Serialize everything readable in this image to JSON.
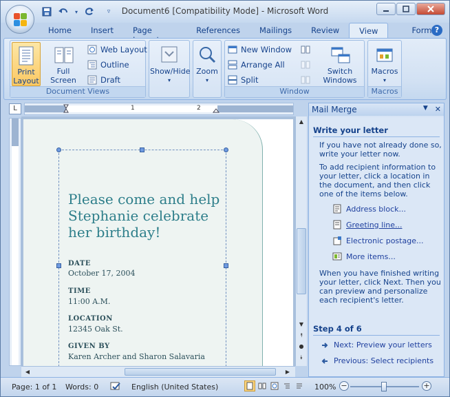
{
  "window": {
    "title": "Document6 [Compatibility Mode] - Microsoft Word"
  },
  "tabs": [
    {
      "label": "Home"
    },
    {
      "label": "Insert"
    },
    {
      "label": "Page Layout"
    },
    {
      "label": "References"
    },
    {
      "label": "Mailings"
    },
    {
      "label": "Review"
    },
    {
      "label": "View"
    },
    {
      "label": "Format"
    }
  ],
  "ribbon": {
    "document_views": {
      "caption": "Document Views",
      "print_layout": "Print Layout",
      "full_screen_reading": "Full Screen Reading",
      "web_layout": "Web Layout",
      "outline": "Outline",
      "draft": "Draft"
    },
    "show_hide": {
      "label": "Show/Hide"
    },
    "zoom": {
      "label": "Zoom"
    },
    "window": {
      "caption": "Window",
      "new_window": "New Window",
      "arrange_all": "Arrange All",
      "split": "Split",
      "switch_windows": "Switch Windows"
    },
    "macros": {
      "caption": "Macros",
      "label": "Macros"
    }
  },
  "ruler": {
    "marks": [
      "1",
      "2"
    ]
  },
  "document": {
    "heading": "Please come and help Stephanie celebrate her birthday!",
    "fields": [
      {
        "label": "DATE",
        "value": "October 17, 2004"
      },
      {
        "label": "TIME",
        "value": "11:00 A.M."
      },
      {
        "label": "LOCATION",
        "value": "12345 Oak St."
      },
      {
        "label": "GIVEN BY",
        "value": "Karen Archer  and Sharon Salavaria"
      }
    ]
  },
  "task_pane": {
    "title": "Mail Merge",
    "section_title": "Write your letter",
    "intro": "If you have not already done so, write your letter now.",
    "instructions": "To add recipient information to your letter, click a location in the document, and then click one of the items below.",
    "items": [
      {
        "label": "Address block...",
        "icon": "address-block-icon"
      },
      {
        "label": "Greeting line...",
        "icon": "greeting-line-icon"
      },
      {
        "label": "Electronic postage...",
        "icon": "electronic-postage-icon"
      },
      {
        "label": "More items...",
        "icon": "more-items-icon"
      }
    ],
    "finish_text": "When you have finished writing your letter, click Next. Then you can preview and personalize each recipient's letter.",
    "step": "Step 4 of 6",
    "next": "Next: Preview your letters",
    "previous": "Previous: Select recipients"
  },
  "status_bar": {
    "page": "Page: 1 of 1",
    "words": "Words: 0",
    "language": "English (United States)",
    "zoom": "100%"
  }
}
